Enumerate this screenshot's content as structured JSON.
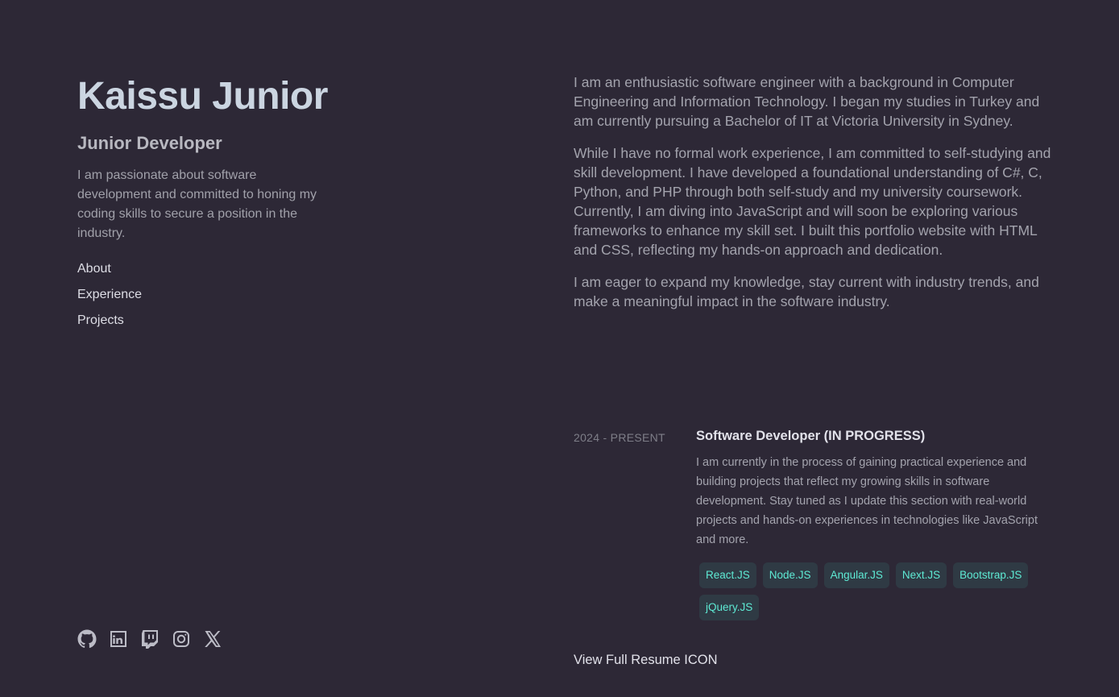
{
  "profile": {
    "name": "Kaissu Junior",
    "role": "Junior Developer",
    "tagline": "I am passionate about software development and committed to honing my coding skills to secure a position in the industry."
  },
  "nav": {
    "about": "About",
    "experience": "Experience",
    "projects": "Projects"
  },
  "social": [
    "github-icon",
    "linkedin-icon",
    "twitch-icon",
    "instagram-icon",
    "x-icon"
  ],
  "about": {
    "p1": "I am an enthusiastic software engineer with a background in Computer Engineering and Information Technology. I began my studies in Turkey and am currently pursuing a Bachelor of IT at Victoria University in Sydney.",
    "p2": "While I have no formal work experience, I am committed to self-studying and skill development. I have developed a foundational understanding of C#, C, Python, and PHP through both self-study and my university coursework. Currently, I am diving into JavaScript and will soon be exploring various frameworks to enhance my skill set. I built this portfolio website with HTML and CSS, reflecting my hands-on approach and dedication.",
    "p3": "I am eager to expand my knowledge, stay current with industry trends, and make a meaningful impact in the software industry."
  },
  "experience": {
    "date": "2024 - PRESENT",
    "title": "Software Developer (IN PROGRESS)",
    "description": "I am currently in the process of gaining practical experience and building projects that reflect my growing skills in software development. Stay tuned as I update this section with real-world projects and hands-on experiences in technologies like JavaScript and more.",
    "tags": [
      "React.JS",
      "Node.JS",
      "Angular.JS",
      "Next.JS",
      "Bootstrap.JS",
      "jQuery.JS"
    ]
  },
  "resume_link": "View Full Resume ICON",
  "colors": {
    "background": "#2d2836",
    "heading": "#cbd5e1",
    "tag_text": "#5eead4",
    "tag_bg": "#2f3a44"
  }
}
